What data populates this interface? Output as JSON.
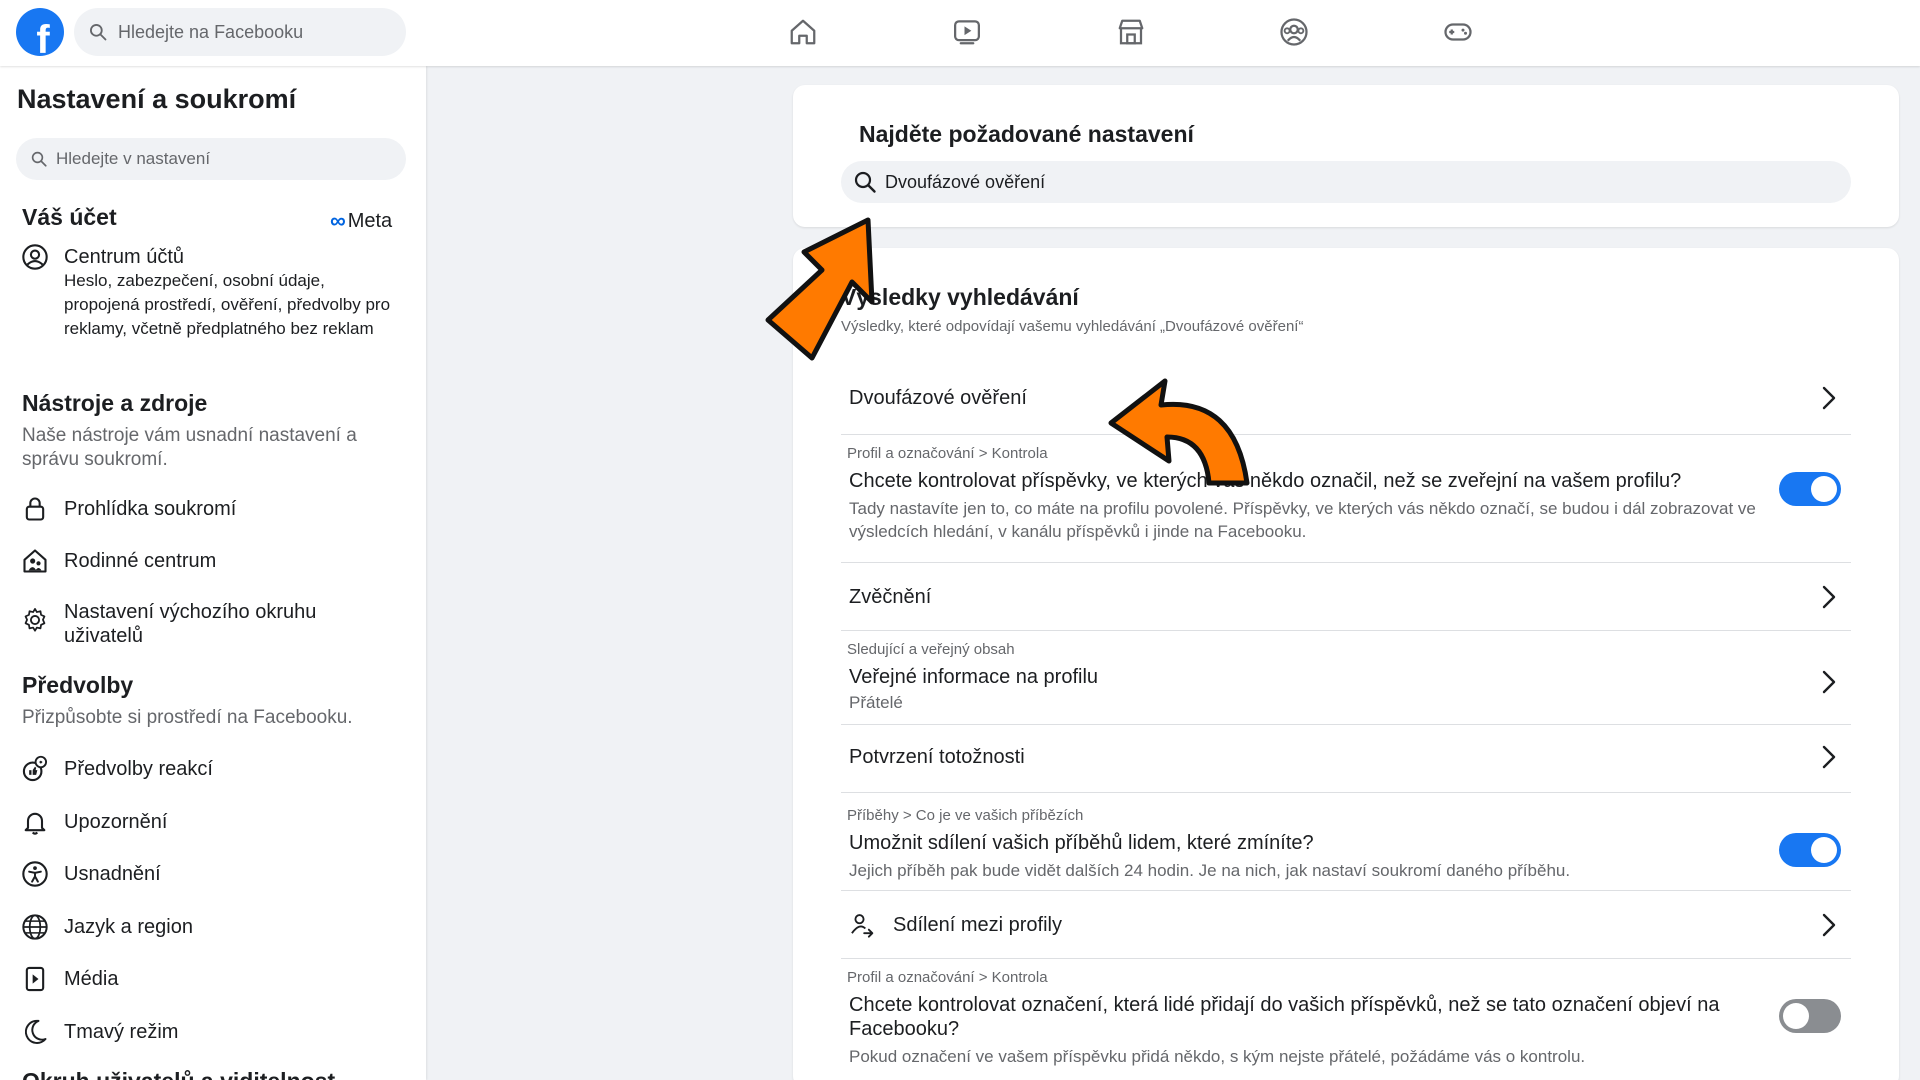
{
  "topbar": {
    "logo_letter": "f",
    "search_placeholder": "Hledejte na Facebooku",
    "nav": [
      "home-icon",
      "video-icon",
      "marketplace-icon",
      "groups-icon",
      "gaming-icon"
    ]
  },
  "sidebar": {
    "title": "Nastavení a soukromí",
    "search_placeholder": "Hledejte v nastavení",
    "account": {
      "heading": "Váš účet",
      "meta_label": "Meta",
      "center_label": "Centrum účtů",
      "center_desc": "Heslo, zabezpečení, osobní údaje, propojená prostředí, ověření, předvolby pro reklamy, včetně předplatného bez reklam"
    },
    "tools": {
      "heading": "Nástroje a zdroje",
      "desc": "Naše nástroje vám usnadní nastavení a správu soukromí.",
      "items": [
        "Prohlídka soukromí",
        "Rodinné centrum",
        "Nastavení výchozího okruhu uživatelů"
      ]
    },
    "prefs": {
      "heading": "Předvolby",
      "desc": "Přizpůsobte si prostředí na Facebooku.",
      "items": [
        "Předvolby reakcí",
        "Upozornění",
        "Usnadnění",
        "Jazyk a region",
        "Média",
        "Tmavý režim"
      ]
    },
    "cutoff_heading": "Okruh uživatelů a viditelnost"
  },
  "find": {
    "title": "Najděte požadované nastavení",
    "query": "Dvoufázové ověření"
  },
  "results": {
    "title": "Výsledky vyhledávání",
    "subtitle": "Výsledky, které odpovídají vašemu vyhledávání „Dvoufázové ověření“",
    "rows": [
      {
        "title": "Dvoufázové ověření"
      },
      {
        "crumb": "Profil a označování  >  Kontrola",
        "title": "Chcete kontrolovat příspěvky, ve kterých vás někdo označil, než se zveřejní na vašem profilu?",
        "desc": "Tady nastavíte jen to, co máte na profilu povolené. Příspěvky, ve kterých vás někdo označí, se budou i dál zobrazovat ve výsledcích hledání, v kanálu příspěvků i jinde na Facebooku.",
        "toggle": true
      },
      {
        "title": "Zvěčnění"
      },
      {
        "crumb": "Sledující a veřejný obsah",
        "title": "Veřejné informace na profilu",
        "desc": "Přátelé"
      },
      {
        "title": "Potvrzení totožnosti"
      },
      {
        "crumb": "Příběhy  >  Co je ve vašich příbězích",
        "title": "Umožnit sdílení vašich příběhů lidem, které zmíníte?",
        "desc": "Jejich příběh pak bude vidět dalších 24 hodin. Je na nich, jak nastaví soukromí daného příběhu.",
        "toggle": true
      },
      {
        "title": "Sdílení mezi profily"
      },
      {
        "crumb": "Profil a označování  >  Kontrola",
        "title": "Chcete kontrolovat označení, která lidé přidají do vašich příspěvků, než se tato označení objeví na Facebooku?",
        "desc": "Pokud označení ve vašem příspěvku přidá někdo, s kým nejste přátelé, požádáme vás o kontrolu.",
        "toggle": false
      }
    ]
  },
  "colors": {
    "accent": "#1877f2",
    "annotation": "#ff7a00"
  }
}
